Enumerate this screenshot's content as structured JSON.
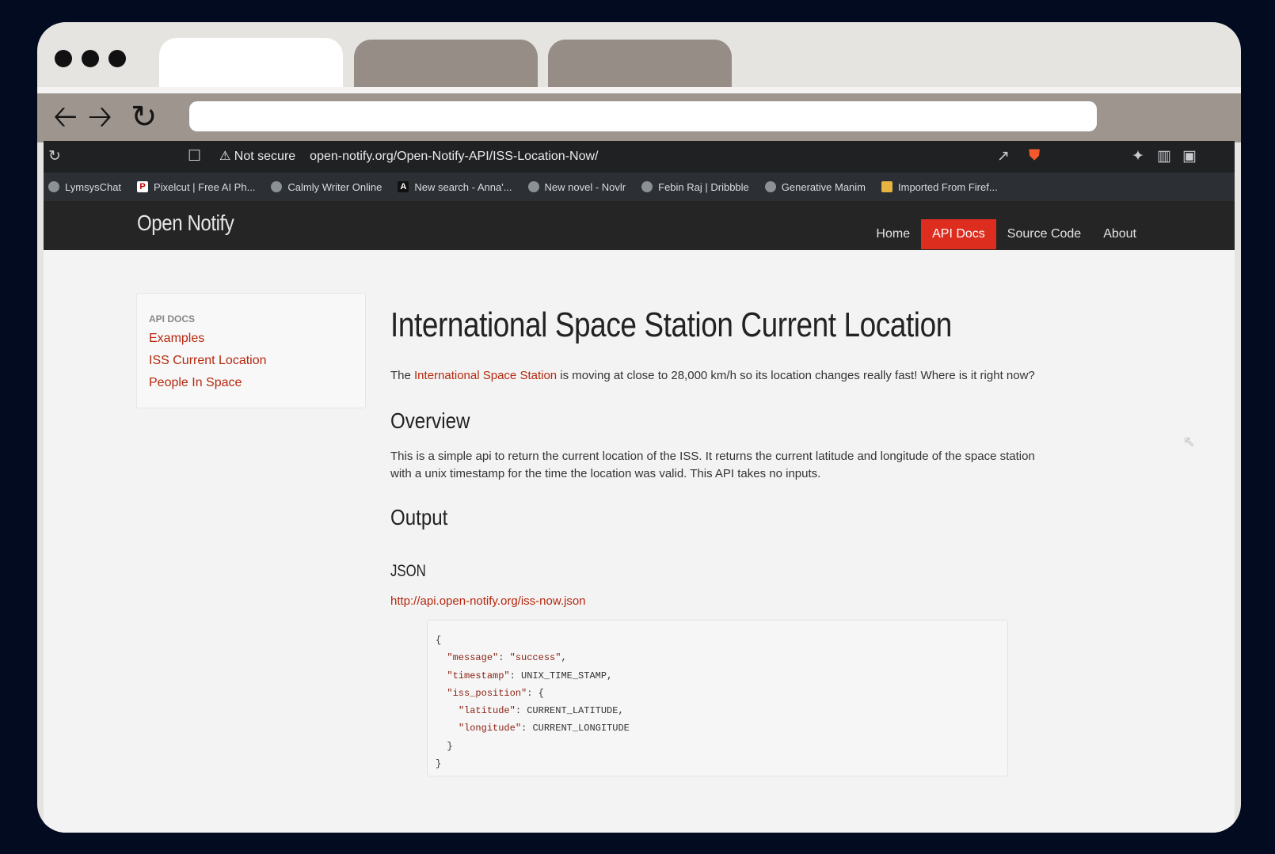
{
  "browser": {
    "url_security": "Not secure",
    "url": "open-notify.org/Open-Notify-API/ISS-Location-Now/"
  },
  "bookmarks": [
    {
      "label": "LymsysChat",
      "icon": "globe-icon"
    },
    {
      "label": "Pixelcut | Free AI Ph...",
      "icon": "pixelcut-icon"
    },
    {
      "label": "Calmly Writer Online",
      "icon": "globe-icon"
    },
    {
      "label": "New search - Anna'...",
      "icon": "anna-icon"
    },
    {
      "label": "New novel - Novlr",
      "icon": "globe-icon"
    },
    {
      "label": "Febin Raj | Dribbble",
      "icon": "globe-icon"
    },
    {
      "label": "Generative Manim",
      "icon": "globe-icon"
    },
    {
      "label": "Imported From Firef...",
      "icon": "folder-icon"
    }
  ],
  "site": {
    "brand": "Open Notify",
    "menu": [
      "Home",
      "API Docs",
      "Source Code",
      "About"
    ],
    "active_menu": "API Docs",
    "accent": "#dc2d1f"
  },
  "sidebar": {
    "heading": "API DOCS",
    "links": [
      "Examples",
      "ISS Current Location",
      "People In Space"
    ]
  },
  "main": {
    "title": "International Space Station Current Location",
    "intro_prefix": "The ",
    "intro_link": "International Space Station",
    "intro_suffix": " is moving at close to 28,000 km/h so its location changes really fast! Where is it right now?",
    "overview_heading": "Overview",
    "overview_text": "This is a simple api to return the current location of the ISS. It returns the current latitude and longitude of the space station with a unix timestamp for the time the location was valid. This API takes no inputs.",
    "output_heading": "Output",
    "json_heading": "JSON",
    "json_url": "http://api.open-notify.org/iss-now.json",
    "code": {
      "open": "{",
      "message_key": "\"message\"",
      "message_val": "\"success\"",
      "timestamp_key": "\"timestamp\"",
      "timestamp_val": "UNIX_TIME_STAMP",
      "position_key": "\"iss_position\"",
      "latitude_key": "\"latitude\"",
      "latitude_val": "CURRENT_LATITUDE",
      "longitude_key": "\"longitude\"",
      "longitude_val": "CURRENT_LONGITUDE",
      "inner_close": "}",
      "close": "}"
    }
  }
}
